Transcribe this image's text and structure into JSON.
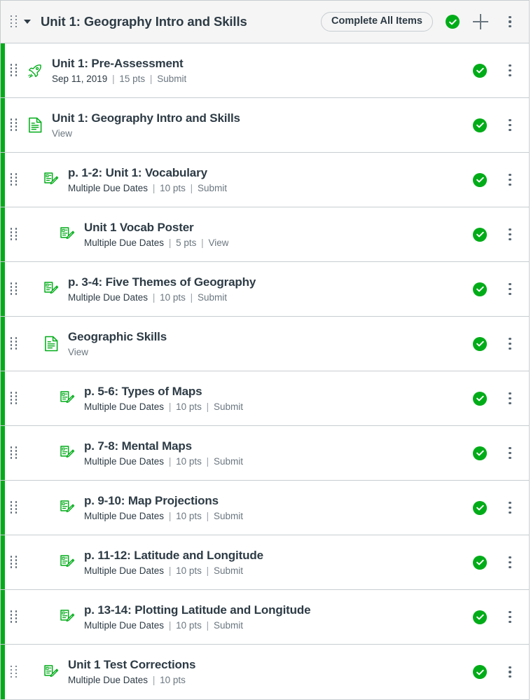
{
  "header": {
    "drag_handle_name": "drag-handle",
    "collapse_label": "collapse-module",
    "title": "Unit 1: Geography Intro and Skills",
    "completion_badge": "Complete All Items",
    "published_icon": "published-check-icon",
    "add_label": "+",
    "kebab_label": "module-options"
  },
  "colors": {
    "accent_green": "#00ac18",
    "icon_green": "#00ac18",
    "header_bg": "#f5f5f5",
    "border": "#c7cdd1",
    "title_text": "#2d3b45",
    "meta_text": "#6b7780"
  },
  "items": [
    {
      "title": "Unit 1: Pre-Assessment",
      "icon": "rocket-icon",
      "indent": 0,
      "due": "Sep 11, 2019",
      "points": "15 pts",
      "action": "Submit",
      "published": "published-check-icon"
    },
    {
      "title": "Unit 1: Geography Intro and Skills",
      "icon": "document-icon",
      "indent": 0,
      "due": "",
      "points": "",
      "action": "View",
      "published": "published-check-icon"
    },
    {
      "title": "p. 1-2: Unit 1: Vocabulary",
      "icon": "assignment-icon",
      "indent": 1,
      "due": "Multiple Due Dates",
      "points": "10 pts",
      "action": "Submit",
      "published": "published-check-icon"
    },
    {
      "title": "Unit 1 Vocab Poster",
      "icon": "assignment-icon",
      "indent": 2,
      "due": "Multiple Due Dates",
      "points": "5 pts",
      "action": "View",
      "published": "published-check-icon"
    },
    {
      "title": "p. 3-4: Five Themes of Geography",
      "icon": "assignment-icon",
      "indent": 1,
      "due": "Multiple Due Dates",
      "points": "10 pts",
      "action": "Submit",
      "published": "published-check-icon"
    },
    {
      "title": "Geographic Skills",
      "icon": "document-icon",
      "indent": 1,
      "due": "",
      "points": "",
      "action": "View",
      "published": "published-check-icon"
    },
    {
      "title": "p. 5-6: Types of Maps",
      "icon": "assignment-icon",
      "indent": 2,
      "due": "Multiple Due Dates",
      "points": "10 pts",
      "action": "Submit",
      "published": "published-check-icon"
    },
    {
      "title": "p. 7-8: Mental Maps",
      "icon": "assignment-icon",
      "indent": 2,
      "due": "Multiple Due Dates",
      "points": "10 pts",
      "action": "Submit",
      "published": "published-check-icon"
    },
    {
      "title": "p. 9-10: Map Projections",
      "icon": "assignment-icon",
      "indent": 2,
      "due": "Multiple Due Dates",
      "points": "10 pts",
      "action": "Submit",
      "published": "published-check-icon"
    },
    {
      "title": "p. 11-12: Latitude and Longitude",
      "icon": "assignment-icon",
      "indent": 2,
      "due": "Multiple Due Dates",
      "points": "10 pts",
      "action": "Submit",
      "published": "published-check-icon"
    },
    {
      "title": "p. 13-14: Plotting Latitude and Longitude",
      "icon": "assignment-icon",
      "indent": 2,
      "due": "Multiple Due Dates",
      "points": "10 pts",
      "action": "Submit",
      "published": "published-check-icon"
    },
    {
      "title": "Unit 1 Test Corrections",
      "icon": "assignment-icon",
      "indent": 1,
      "due": "Multiple Due Dates",
      "points": "10 pts",
      "action": "",
      "published": "published-check-icon"
    }
  ]
}
